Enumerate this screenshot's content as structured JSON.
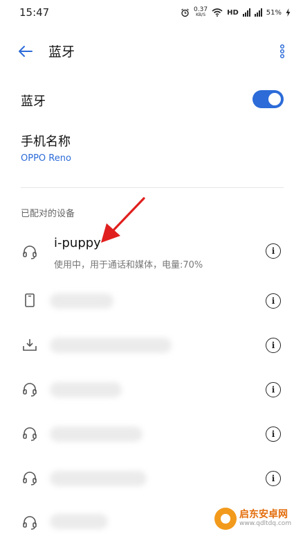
{
  "status_bar": {
    "time": "15:47",
    "speed_value": "0.37",
    "speed_unit": "KB/S",
    "network_label": "HD",
    "battery": "51%"
  },
  "title_bar": {
    "title": "蓝牙"
  },
  "bluetooth_toggle": {
    "label": "蓝牙",
    "enabled": true
  },
  "device_name": {
    "label": "手机名称",
    "value": "OPPO Reno"
  },
  "paired_section": {
    "header": "已配对的设备",
    "devices": [
      {
        "icon": "headset-icon",
        "name": "i-puppy",
        "status": "使用中，用于通话和媒体，电量:70%"
      },
      {
        "icon": "phone-icon",
        "name": "",
        "status": ""
      },
      {
        "icon": "input-device-icon",
        "name": "",
        "status": ""
      },
      {
        "icon": "headset-icon",
        "name": "",
        "status": ""
      },
      {
        "icon": "headset-icon",
        "name": "",
        "status": ""
      },
      {
        "icon": "headset-icon",
        "name": "",
        "status": ""
      },
      {
        "icon": "headset-icon",
        "name": "",
        "status": ""
      }
    ]
  },
  "colors": {
    "accent": "#2c6bd8",
    "annotation_arrow": "#e0201e"
  },
  "watermark": {
    "title": "启东安卓网",
    "url": "www.qdltdq.com"
  }
}
